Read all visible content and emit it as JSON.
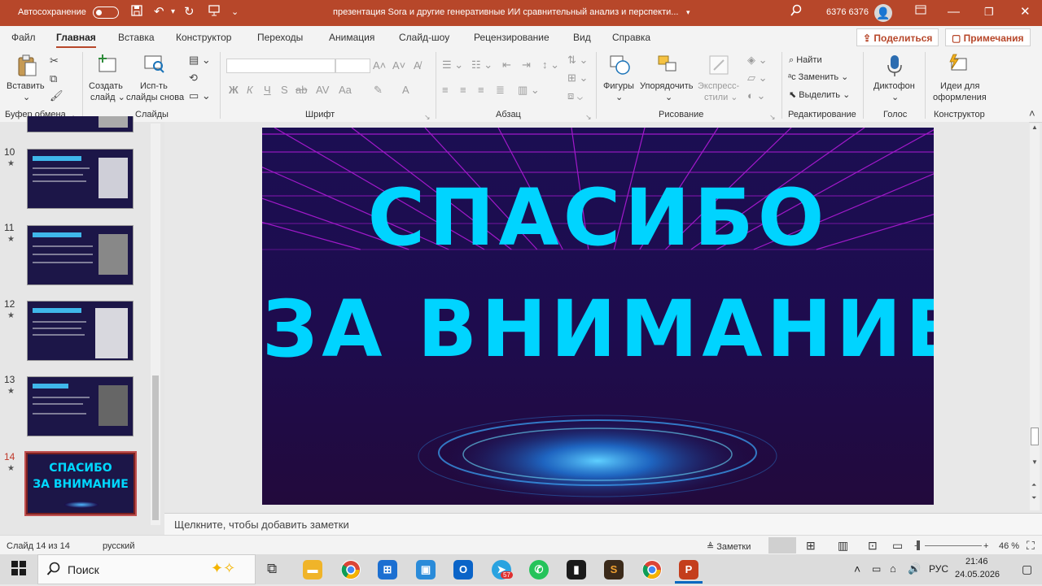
{
  "titlebar": {
    "autosave_label": "Автосохранение",
    "doc_title": "презентация Sora и другие генеративные ИИ сравнительный анализ и перспекти...",
    "user_name": "6376 6376"
  },
  "menu": {
    "tabs": [
      "Файл",
      "Главная",
      "Вставка",
      "Конструктор",
      "Переходы",
      "Анимация",
      "Слайд-шоу",
      "Рецензирование",
      "Вид",
      "Справка"
    ],
    "share_label": "Поделиться",
    "comments_label": "Примечания"
  },
  "ribbon": {
    "paste": "Вставить",
    "new_slide": [
      "Создать",
      "слайд"
    ],
    "reuse": [
      "Исп-ть",
      "слайды снова"
    ],
    "shapes": "Фигуры",
    "arrange": "Упорядочить",
    "quick_styles": [
      "Экспресс-",
      "стили"
    ],
    "find": "Найти",
    "replace": "Заменить",
    "select": "Выделить",
    "dictate": "Диктофон",
    "designer": [
      "Идеи для",
      "оформления"
    ],
    "groups": [
      "Буфер обмена",
      "Слайды",
      "Шрифт",
      "Абзац",
      "Рисование",
      "Редактирование",
      "Голос",
      "Конструктор"
    ],
    "font_buttons": [
      "Ж",
      "К",
      "Ч",
      "S",
      "ab",
      "AV",
      "Aa",
      "A"
    ]
  },
  "thumbnails": {
    "items": [
      {
        "num": "10",
        "star": "★"
      },
      {
        "num": "11",
        "star": "★"
      },
      {
        "num": "12",
        "star": "★"
      },
      {
        "num": "13",
        "star": "★"
      },
      {
        "num": "14",
        "star": "★",
        "line1": "СПАСИБО",
        "line2": "ЗА ВНИМАНИЕ"
      }
    ]
  },
  "slide": {
    "line1": "СПАСИБО",
    "line2": "ЗА ВНИМАНИЕ",
    "text_color": "#00d4ff",
    "bg_color": "#1a0c4a",
    "grid_color": "#b01bd8"
  },
  "notes": {
    "placeholder": "Щелкните, чтобы добавить заметки"
  },
  "status": {
    "slide_count": "Слайд 14 из 14",
    "language": "русский",
    "notes_btn": "Заметки",
    "zoom": "46 %"
  },
  "taskbar": {
    "search": "Поиск",
    "lang": "РУС",
    "time": "21:46",
    "date": "24.05.2026",
    "badge": "57"
  },
  "colors": {
    "accent": "#b7472a"
  }
}
